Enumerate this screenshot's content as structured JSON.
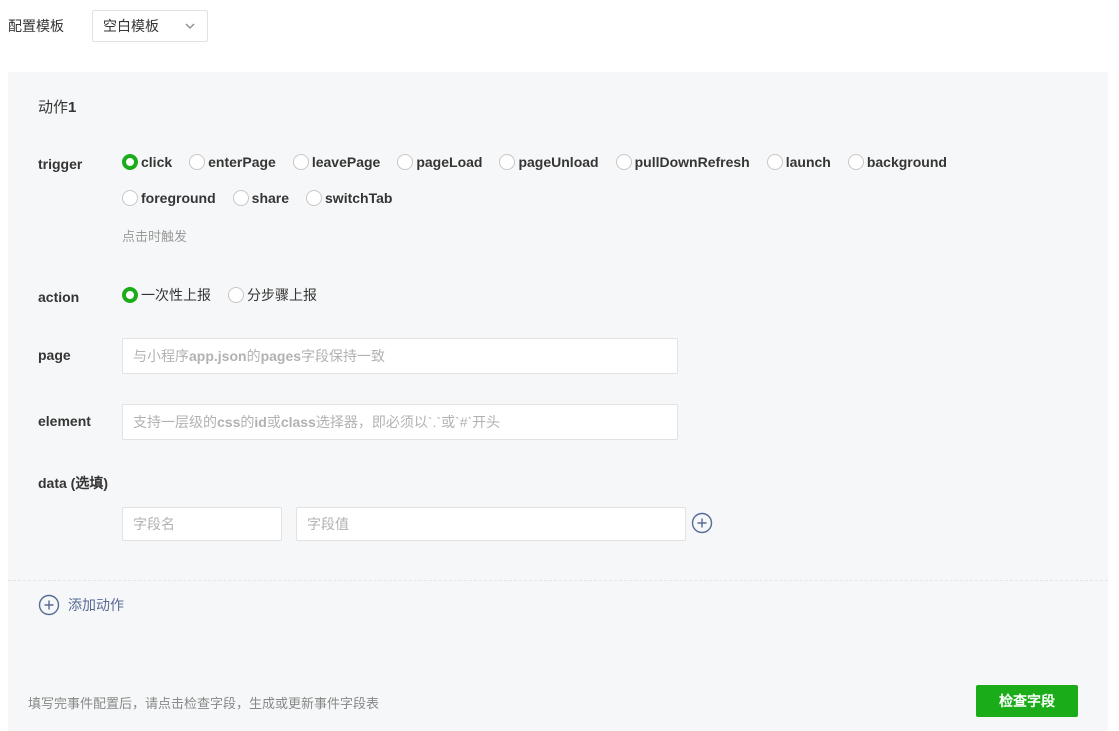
{
  "template": {
    "label": "配置模板",
    "selected": "空白模板"
  },
  "action": {
    "title_prefix": "动作",
    "title_number": "1",
    "trigger": {
      "label": "trigger",
      "options": [
        "click",
        "enterPage",
        "leavePage",
        "pageLoad",
        "pageUnload",
        "pullDownRefresh",
        "launch",
        "background",
        "foreground",
        "share",
        "switchTab"
      ],
      "selected": "click",
      "hint": "点击时触发"
    },
    "report": {
      "label": "action",
      "options": [
        "一次性上报",
        "分步骤上报"
      ],
      "selected": "一次性上报"
    },
    "page": {
      "label": "page",
      "placeholder_parts": [
        "与小程序",
        "app.json",
        "的",
        "pages",
        "字段保持一致"
      ]
    },
    "element": {
      "label": "element",
      "placeholder_parts": [
        "支持一层级的",
        "css",
        "的",
        "id",
        "或",
        "class",
        "选择器，即必须以`.`或`#`开头"
      ]
    },
    "data": {
      "label": "data (选填)",
      "name_placeholder": "字段名",
      "value_placeholder": "字段值"
    }
  },
  "add_action_label": "添加动作",
  "footer": {
    "hint": "填写完事件配置后，请点击检查字段，生成或更新事件字段表",
    "check_button": "检查字段"
  },
  "colors": {
    "primary_green": "#1aad19",
    "link_blue": "#576b95",
    "panel_bg": "#f6f7f8"
  }
}
